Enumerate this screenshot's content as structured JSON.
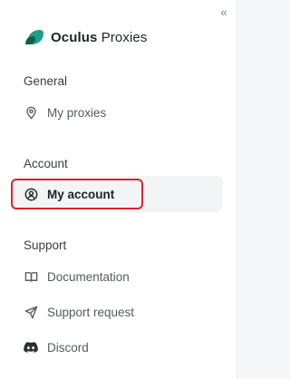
{
  "brand": {
    "name_bold": "Oculus",
    "name_light": "Proxies",
    "accent": "#1f9e84"
  },
  "sidebar": {
    "collapse_glyph": "«",
    "sections": [
      {
        "label": "General",
        "items": [
          {
            "label": "My proxies",
            "icon": "location-pin-icon"
          }
        ]
      },
      {
        "label": "Account",
        "items": [
          {
            "label": "My account",
            "icon": "user-circle-icon",
            "active": true
          }
        ]
      },
      {
        "label": "Support",
        "items": [
          {
            "label": "Documentation",
            "icon": "book-icon"
          },
          {
            "label": "Support request",
            "icon": "send-icon"
          },
          {
            "label": "Discord",
            "icon": "discord-icon"
          }
        ]
      }
    ]
  },
  "highlight_color": "#e0222b"
}
